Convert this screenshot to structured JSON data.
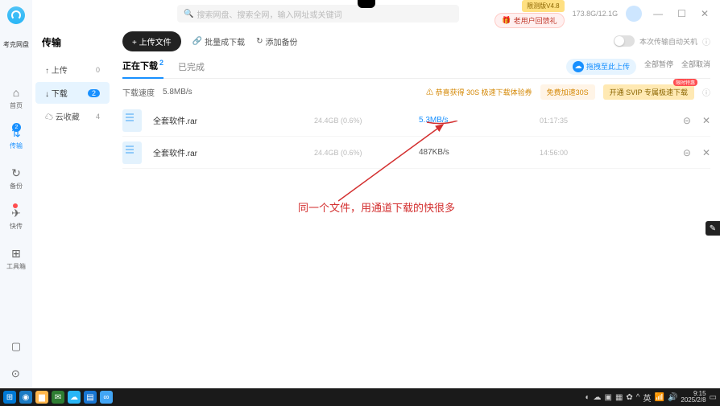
{
  "brand": "考克网盘",
  "nav": {
    "items": [
      {
        "icon": "⌂",
        "label": "首页"
      },
      {
        "icon": "⇅",
        "label": "传输",
        "badge": "2",
        "active": true
      },
      {
        "icon": "↻",
        "label": "备份"
      },
      {
        "icon": "✈",
        "label": "快传"
      },
      {
        "icon": "⊞",
        "label": "工具箱"
      }
    ]
  },
  "search_placeholder": "搜索网盘、搜索全网，输入网址或关键词",
  "top": {
    "promo_tag": "限测版V4.8",
    "gift_label": "老用户回馈礼",
    "storage": "173.8G/12.1G",
    "win_min": "—",
    "win_max": "☐",
    "win_close": "✕"
  },
  "sub": {
    "title": "传输",
    "items": [
      {
        "ico": "↑",
        "label": "上传",
        "cnt": "0"
      },
      {
        "ico": "↓",
        "label": "下载",
        "cnt": "2",
        "active": true
      },
      {
        "ico": "☁",
        "label": "云收藏",
        "cnt": "4"
      }
    ]
  },
  "toolbar": {
    "upload": "+ 上传文件",
    "batch": "批量成下载",
    "cloud": "添加备份"
  },
  "toggle_label": "本次传输自动关机",
  "tabs": {
    "downloading": "正在下载",
    "downloading_cnt": "2",
    "done": "已完成"
  },
  "chips": {
    "drag": "拖拽至此上传",
    "pause": "全部暂停",
    "delete": "全部取消"
  },
  "speedbar": {
    "label": "下载速度",
    "speed": "5.8MB/s",
    "warn": "⚠ 恭喜获得 30S 极速下载体验券",
    "btn1": "免费加速30S",
    "btn2": "开通 SVIP 专属极速下载",
    "btn2_tag": "限时特惠"
  },
  "rows": [
    {
      "name": "全套软件.rar",
      "size": "24.4GB (0.6%)",
      "speed": "5.3MB/s",
      "time": "01:17:35",
      "hi": true
    },
    {
      "name": "全套软件.rar",
      "size": "24.4GB (0.6%)",
      "speed": "487KB/s",
      "time": "14:56:00",
      "hi": false
    }
  ],
  "annotation": "同一个文件，用通道下载的快很多",
  "taskbar": {
    "time": "9:15",
    "date": "2025/2/8",
    "ime": "英"
  }
}
